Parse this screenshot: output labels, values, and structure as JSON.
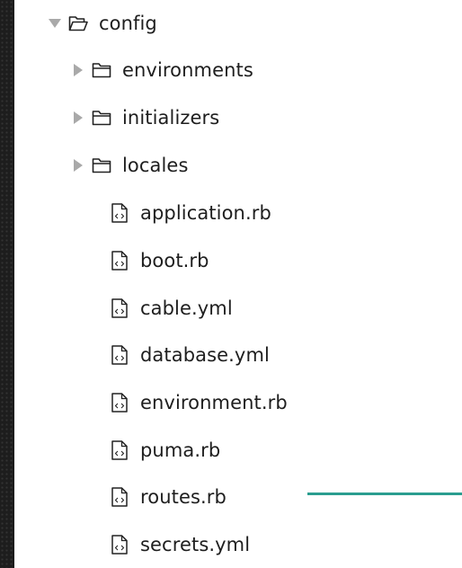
{
  "tree": {
    "root": {
      "label": "config",
      "icon": "folder-open-icon",
      "expanded": true
    },
    "folders": [
      {
        "label": "environments",
        "icon": "folder-icon",
        "expanded": false
      },
      {
        "label": "initializers",
        "icon": "folder-icon",
        "expanded": false
      },
      {
        "label": "locales",
        "icon": "folder-icon",
        "expanded": false
      }
    ],
    "files": [
      {
        "label": "application.rb",
        "icon": "code-file-icon"
      },
      {
        "label": "boot.rb",
        "icon": "code-file-icon"
      },
      {
        "label": "cable.yml",
        "icon": "code-file-icon"
      },
      {
        "label": "database.yml",
        "icon": "code-file-icon"
      },
      {
        "label": "environment.rb",
        "icon": "code-file-icon"
      },
      {
        "label": "puma.rb",
        "icon": "code-file-icon"
      },
      {
        "label": "routes.rb",
        "icon": "code-file-icon"
      },
      {
        "label": "secrets.yml",
        "icon": "code-file-icon"
      }
    ]
  },
  "colors": {
    "arrow": "#a9a9a9",
    "icon_stroke": "#222222",
    "text": "#1e1e1e",
    "pointer_line": "#2a9d8f",
    "background": "#1d1d1d"
  }
}
